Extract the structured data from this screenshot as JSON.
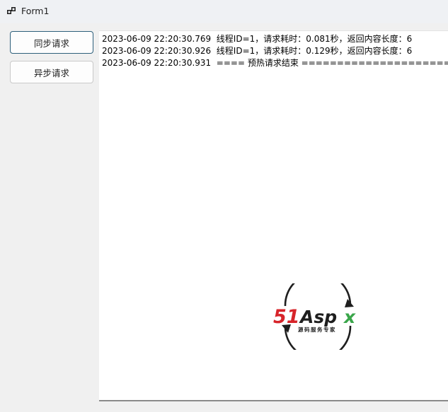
{
  "window": {
    "title": "Form1",
    "icon": "winforms-app-icon"
  },
  "buttons": {
    "sync_label": "同步请求",
    "async_label": "异步请求"
  },
  "log": {
    "lines": [
      "2023-06-09 22:20:30.769  线程ID=1，请求耗时：0.081秒，返回内容长度：6",
      "2023-06-09 22:20:30.926  线程ID=1，请求耗时：0.129秒，返回内容长度：6",
      "2023-06-09 22:20:30.931  ==== 预热请求结束 =============================="
    ]
  },
  "watermark": {
    "logo_text": "51Aspx",
    "caption": "源码服务专家",
    "colors": {
      "red": "#d7242a",
      "dark": "#1e1e1e",
      "green": "#3aa64a"
    }
  }
}
